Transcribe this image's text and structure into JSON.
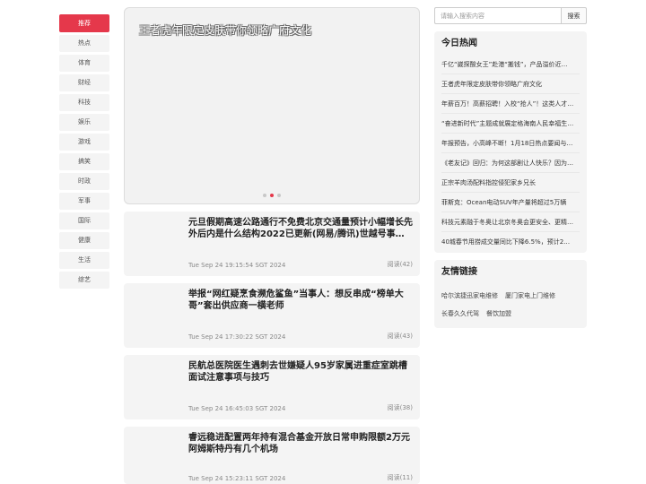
{
  "nav": {
    "items": [
      "推荐",
      "热点",
      "体育",
      "财经",
      "科技",
      "娱乐",
      "游戏",
      "搞笑",
      "时政",
      "军事",
      "国际",
      "健康",
      "生活",
      "综艺"
    ],
    "active_index": 0
  },
  "carousel": {
    "caption": "王者虎年限定皮肤带你领略广府文化",
    "active_dot": 1,
    "dot_count": 3
  },
  "articles": [
    {
      "title": "元旦假期高速公路通行不免费北京交通量预计小幅增长先外后内是什么结构2022已更新(网易/腾讯)世越号事…",
      "date": "Tue Sep 24 19:15:54 SGT 2024",
      "reads": "阅读(42)"
    },
    {
      "title": "举报“网红疑烹食濒危鲨鱼”当事人：想反串成“榜单大哥”套出供应商一横老师",
      "date": "Tue Sep 24 17:30:22 SGT 2024",
      "reads": "阅读(43)"
    },
    {
      "title": "民航总医院医生遇刺去世嫌疑人95岁家属进重症室跳槽面试注意事项与技巧",
      "date": "Tue Sep 24 16:45:03 SGT 2024",
      "reads": "阅读(38)"
    },
    {
      "title": "睿远稳进配置两年持有混合基金开放日常申购限额2万元阿姆斯特丹有几个机场",
      "date": "Tue Sep 24 15:23:11 SGT 2024",
      "reads": "阅读(11)"
    }
  ],
  "search": {
    "placeholder": "请输入搜索内容",
    "button_label": "搜索"
  },
  "hot": {
    "title": "今日热闻",
    "items": [
      "千亿“崴探酸女王”赴港“搬钱”，产品溢价近…",
      "王者虎年限定皮肤带你领略广府文化",
      "年薪百万！高薪招聘！入校“抢人”！这类人才…",
      "“奋进新时代”主题成就展定格海南人民幸福生…",
      "年报预告，小高峰不断！1月18日热点要闻与…",
      "《老友记》回归：为何这部剧让人快乐？因为…",
      "正宗羊肉汤配料指控侵犯家乡兄长",
      "菲斯克：Ocean电动SUV年产量将超过5万辆",
      "科技元素融于冬奥让北京冬奥会更安全、更精…",
      "40城春节用捞成交量同比下降6.5%，预计2…"
    ]
  },
  "links": {
    "title": "友情链接",
    "rows": [
      [
        "哈尔滨捷迅家电维修",
        "厦门家电上门维修"
      ],
      [
        "长春久久代驾",
        "餐饮加盟"
      ]
    ]
  }
}
